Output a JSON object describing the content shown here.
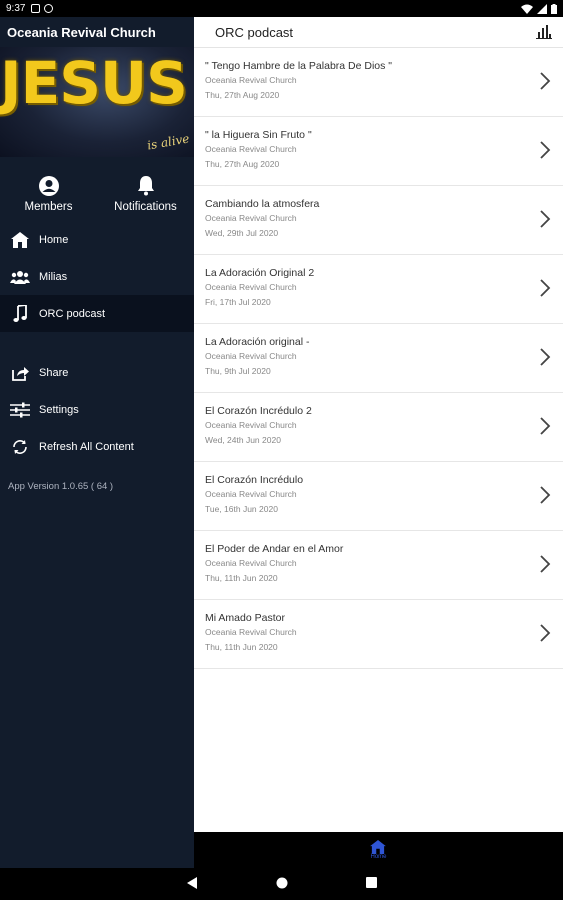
{
  "status_bar": {
    "time": "9:37"
  },
  "sidebar": {
    "title": "Oceania Revival Church",
    "hero": {
      "text_main": "JESUS",
      "text_tag": "is alive"
    },
    "top_icons": [
      {
        "label": "Members",
        "icon": "person-icon"
      },
      {
        "label": "Notifications",
        "icon": "bell-icon"
      }
    ],
    "nav": [
      {
        "label": "Home",
        "icon": "home-icon"
      },
      {
        "label": "Milias",
        "icon": "group-icon"
      },
      {
        "label": "ORC podcast",
        "icon": "music-note-icon",
        "active": true
      },
      {
        "label": "Share",
        "icon": "share-icon"
      },
      {
        "label": "Settings",
        "icon": "sliders-icon"
      },
      {
        "label": "Refresh All Content",
        "icon": "refresh-icon"
      }
    ],
    "version": "App Version 1.0.65 ( 64 )"
  },
  "content": {
    "title": "ORC podcast",
    "episodes": [
      {
        "title": "\" Tengo Hambre de la Palabra De Dios \"",
        "author": "Oceania Revival Church",
        "date": "Thu, 27th Aug 2020"
      },
      {
        "title": "\" la Higuera Sin Fruto \"",
        "author": "Oceania Revival Church",
        "date": "Thu, 27th Aug 2020"
      },
      {
        "title": "Cambiando la atmosfera",
        "author": "Oceania Revival Church",
        "date": "Wed, 29th Jul 2020"
      },
      {
        "title": "La Adoración Original 2",
        "author": "Oceania Revival Church",
        "date": "Fri, 17th Jul 2020"
      },
      {
        "title": "La Adoración original -",
        "author": "Oceania Revival Church",
        "date": "Thu, 9th Jul 2020"
      },
      {
        "title": "El Corazón Incrédulo 2",
        "author": "Oceania Revival Church",
        "date": "Wed, 24th Jun 2020"
      },
      {
        "title": "El Corazón Incrédulo",
        "author": "Oceania Revival Church",
        "date": "Tue, 16th Jun 2020"
      },
      {
        "title": "El Poder de Andar en el Amor",
        "author": "Oceania Revival Church",
        "date": "Thu, 11th Jun 2020"
      },
      {
        "title": "Mi Amado Pastor",
        "author": "Oceania Revival Church",
        "date": "Thu, 11th Jun 2020"
      }
    ]
  },
  "tabbar": {
    "home_label": "Home"
  },
  "colors": {
    "sidebar_bg": "#121c2c",
    "accent": "#2f55d4",
    "hero_text": "#f2c81c"
  }
}
